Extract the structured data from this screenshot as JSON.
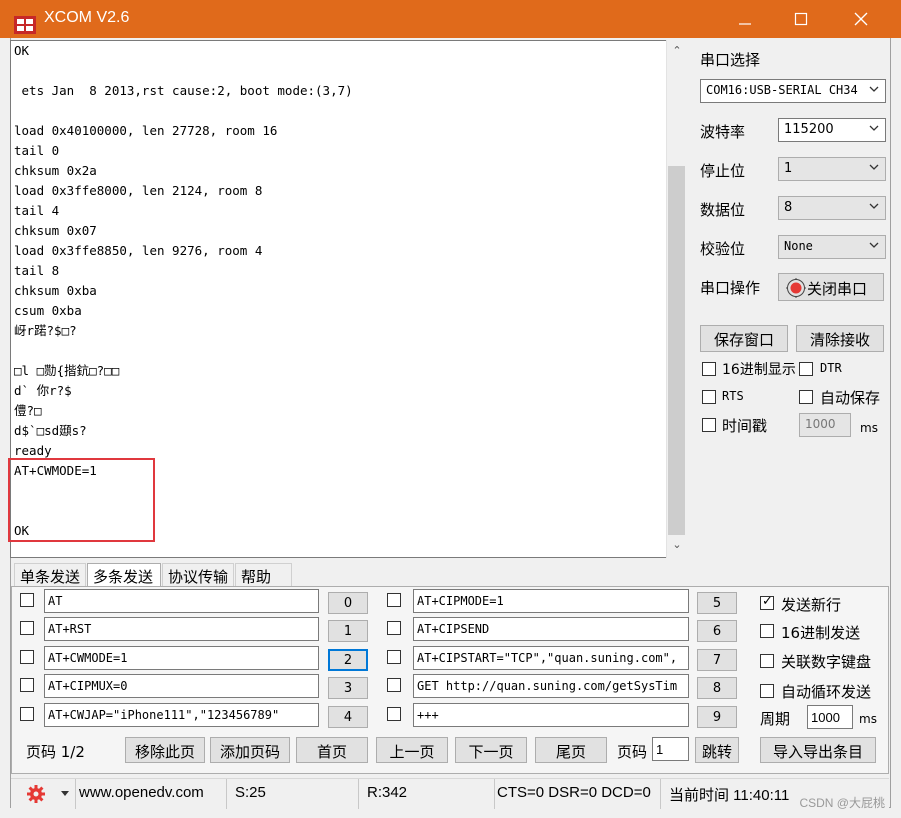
{
  "window": {
    "title": "XCOM V2.6"
  },
  "receive": {
    "lines": [
      "OK",
      "",
      " ets Jan  8 2013,rst cause:2, boot mode:(3,7)",
      "",
      "load 0x40100000, len 27728, room 16",
      "tail 0",
      "chksum 0x2a",
      "load 0x3ffe8000, len 2124, room 8",
      "tail 4",
      "chksum 0x07",
      "load 0x3ffe8850, len 9276, room 4",
      "tail 8",
      "chksum 0xba",
      "csum 0xba",
      "岈r蹃?$□?",
      "",
      "□l □勚{揩鈧□?□□",
      "d` 你r?$",
      "僼?□",
      "d$`□sd頲s?",
      "ready",
      "AT+CWMODE=1",
      "",
      "",
      "OK"
    ]
  },
  "settings": {
    "port_label": "串口选择",
    "port_value": "COM16:USB-SERIAL CH34",
    "baud_label": "波特率",
    "baud_value": "115200",
    "stop_label": "停止位",
    "stop_value": "1",
    "data_label": "数据位",
    "data_value": "8",
    "parity_label": "校验位",
    "parity_value": "None",
    "op_label": "串口操作",
    "op_button": "关闭串口",
    "save_window": "保存窗口",
    "clear_recv": "清除接收",
    "hex_display": "16进制显示",
    "dtr": "DTR",
    "rts": "RTS",
    "auto_save": "自动保存",
    "timestamp": "时间戳",
    "timestamp_value": "1000",
    "ms": "ms"
  },
  "tabs": [
    "单条发送",
    "多条发送",
    "协议传输",
    "帮助"
  ],
  "multi_send": {
    "left": [
      {
        "text": "AT",
        "num": "0"
      },
      {
        "text": "AT+RST",
        "num": "1"
      },
      {
        "text": "AT+CWMODE=1",
        "num": "2"
      },
      {
        "text": "AT+CIPMUX=0",
        "num": "3"
      },
      {
        "text": "AT+CWJAP=\"iPhone111\",\"123456789\"",
        "num": "4"
      }
    ],
    "right": [
      {
        "text": "AT+CIPMODE=1",
        "num": "5"
      },
      {
        "text": "AT+CIPSEND",
        "num": "6"
      },
      {
        "text": "AT+CIPSTART=\"TCP\",\"quan.suning.com\",",
        "num": "7"
      },
      {
        "text": "GET http://quan.suning.com/getSysTim",
        "num": "8"
      },
      {
        "text": "+++",
        "num": "9"
      }
    ],
    "options": {
      "newline": "发送新行",
      "hex_send": "16进制发送",
      "link_keyboard": "关联数字键盘",
      "auto_loop": "自动循环发送",
      "period_label": "周期",
      "period_value": "1000",
      "ms": "ms"
    },
    "pager": {
      "page_text": "页码 1/2",
      "remove": "移除此页",
      "add": "添加页码",
      "first": "首页",
      "prev": "上一页",
      "next": "下一页",
      "last": "尾页",
      "goto_label": "页码",
      "goto_value": "1",
      "jump": "跳转",
      "import_export": "导入导出条目"
    }
  },
  "status": {
    "url": "www.openedv.com",
    "sent": "S:25",
    "received": "R:342",
    "lines": "CTS=0 DSR=0 DCD=0",
    "time": "当前时间 11:40:11"
  },
  "watermark": "CSDN @大屁桃",
  "colors": {
    "titlebar": "#e06a1b",
    "highlight": "#e0383e",
    "focus": "#0078d7"
  }
}
